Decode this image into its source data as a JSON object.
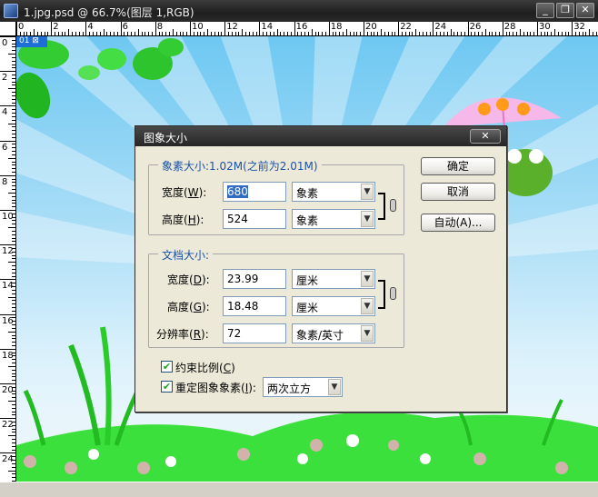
{
  "window": {
    "title": "1.jpg.psd @ 66.7%(图层 1,RGB)",
    "minimize_glyph": "_",
    "restore_glyph": "❐",
    "close_glyph": "✕"
  },
  "ruler": {
    "top_labels": [
      "0",
      "2",
      "4",
      "6",
      "8",
      "10",
      "12",
      "14",
      "16",
      "18",
      "20",
      "22",
      "24",
      "26",
      "28",
      "30",
      "32"
    ],
    "left_labels": [
      "0",
      "2",
      "4",
      "6",
      "8",
      "10",
      "12",
      "14",
      "16",
      "18",
      "20",
      "22",
      "24"
    ]
  },
  "canvas": {
    "layer_tab": "01 ⊠"
  },
  "dialog": {
    "title": "图象大小",
    "close_glyph": "✕",
    "pixel_group": {
      "legend": "象素大小:1.02M(之前为2.01M)",
      "width_label": "宽度(",
      "width_key": "W",
      "width_tail": "):",
      "width_value": "680",
      "width_unit": "象素",
      "height_label": "高度(",
      "height_key": "H",
      "height_tail": "):",
      "height_value": "524",
      "height_unit": "象素"
    },
    "doc_group": {
      "legend": "文档大小:",
      "width_label": "宽度(",
      "width_key": "D",
      "width_tail": "):",
      "width_value": "23.99",
      "width_unit": "厘米",
      "height_label": "高度(",
      "height_key": "G",
      "height_tail": "):",
      "height_value": "18.48",
      "height_unit": "厘米",
      "res_label": "分辨率(",
      "res_key": "R",
      "res_tail": "):",
      "res_value": "72",
      "res_unit": "象素/英寸"
    },
    "buttons": {
      "ok": "确定",
      "cancel": "取消",
      "auto": "自动(A)..."
    },
    "constrain": {
      "label_a": "约束比例(",
      "key": "C",
      "label_b": ")",
      "checked": true
    },
    "resample": {
      "label_a": "重定图象象素(",
      "key": "I",
      "label_b": "):",
      "checked": true,
      "method": "两次立方"
    },
    "arrow_glyph": "▼",
    "check_glyph": "✔"
  }
}
